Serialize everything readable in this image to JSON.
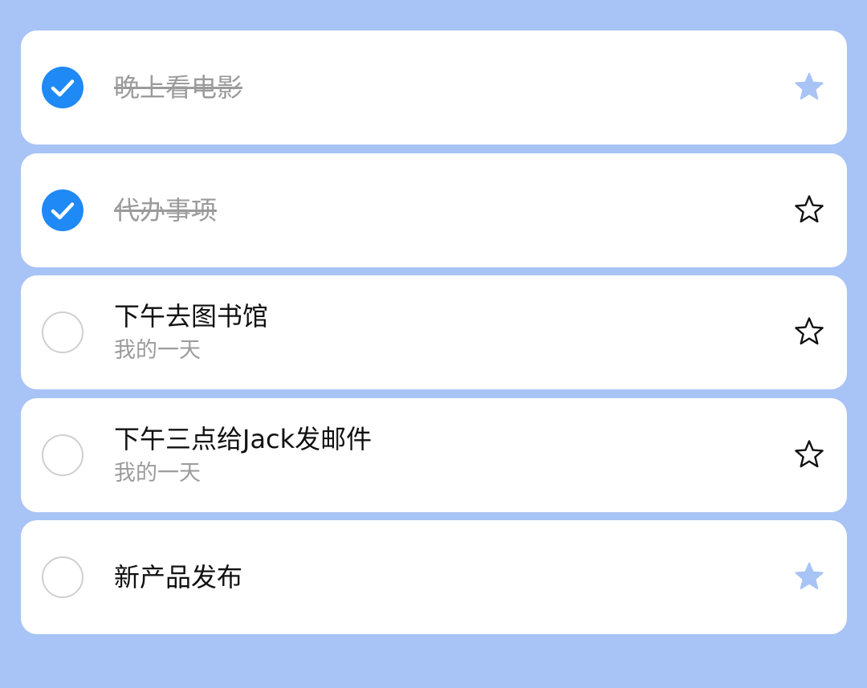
{
  "colors": {
    "background": "#a8c3f5",
    "check_done": "#1f89f5",
    "star_filled": "#a8c3f5",
    "star_outline": "#111111",
    "muted_text": "#9b9b9b"
  },
  "tasks": [
    {
      "title": "晚上看电影",
      "subtitle": "",
      "completed": true,
      "starred": true,
      "check_icon": "check-circle-filled-icon",
      "star_icon": "star-filled-icon"
    },
    {
      "title": "代办事项",
      "subtitle": "",
      "completed": true,
      "starred": false,
      "check_icon": "check-circle-filled-icon",
      "star_icon": "star-outline-icon"
    },
    {
      "title": "下午去图书馆",
      "subtitle": "我的一天",
      "completed": false,
      "starred": false,
      "check_icon": "circle-outline-icon",
      "star_icon": "star-outline-icon"
    },
    {
      "title": "下午三点给Jack发邮件",
      "subtitle": "我的一天",
      "completed": false,
      "starred": false,
      "check_icon": "circle-outline-icon",
      "star_icon": "star-outline-icon"
    },
    {
      "title": "新产品发布",
      "subtitle": "",
      "completed": false,
      "starred": true,
      "check_icon": "circle-outline-icon",
      "star_icon": "star-filled-icon"
    }
  ]
}
